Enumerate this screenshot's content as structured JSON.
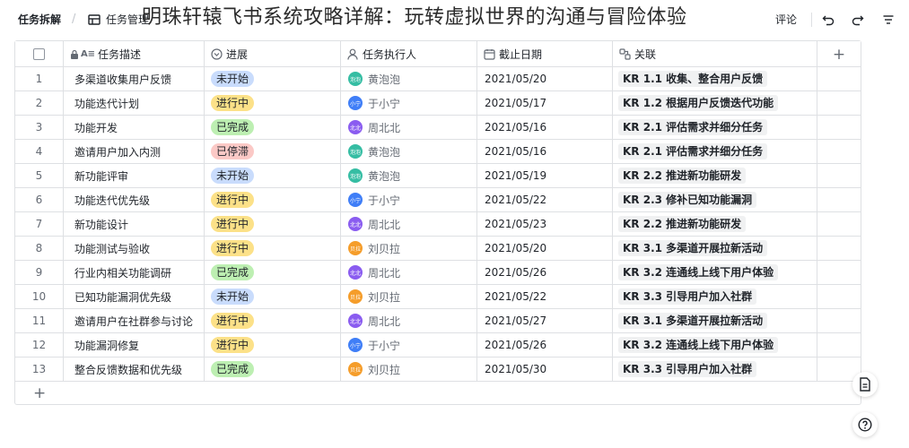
{
  "topbar": {
    "tab_active": "任务拆解",
    "tab_second": "任务管理",
    "overlay_title": "明珠轩辕飞书系统攻略详解：玩转虚拟世界的沟通与冒险体验",
    "comment_label": "评论"
  },
  "columns": {
    "task": "任务描述",
    "progress": "进展",
    "owner": "任务执行人",
    "due": "截止日期",
    "link": "关联",
    "add": "+"
  },
  "colors": {
    "未开始": "#c9dcfc",
    "进行中": "#fce188",
    "已完成": "#bdefb2",
    "已停滞": "#fbc9c6",
    "黄泡泡": "#35bda3",
    "于小宁": "#3f7ef7",
    "周北北": "#8a5cf0",
    "刘贝拉": "#f59d2a"
  },
  "avatar_text": {
    "黄泡泡": "泡泡",
    "于小宁": "小宁",
    "周北北": "北北",
    "刘贝拉": "贝拉"
  },
  "rows": [
    {
      "num": "1",
      "task": "多渠道收集用户反馈",
      "progress": "未开始",
      "owner": "黄泡泡",
      "due": "2021/05/20",
      "kr": "KR 1.1 收集、整合用户反馈"
    },
    {
      "num": "2",
      "task": "功能迭代计划",
      "progress": "进行中",
      "owner": "于小宁",
      "due": "2021/05/17",
      "kr": "KR 1.2 根据用户反馈迭代功能"
    },
    {
      "num": "3",
      "task": "功能开发",
      "progress": "已完成",
      "owner": "周北北",
      "due": "2021/05/16",
      "kr": "KR 2.1 评估需求并细分任务"
    },
    {
      "num": "4",
      "task": "邀请用户加入内测",
      "progress": "已停滞",
      "owner": "黄泡泡",
      "due": "2021/05/16",
      "kr": "KR 2.1 评估需求并细分任务"
    },
    {
      "num": "5",
      "task": "新功能评审",
      "progress": "未开始",
      "owner": "黄泡泡",
      "due": "2021/05/19",
      "kr": "KR 2.2 推进新功能研发"
    },
    {
      "num": "6",
      "task": "功能迭代优先级",
      "progress": "进行中",
      "owner": "于小宁",
      "due": "2021/05/22",
      "kr": "KR 2.3 修补已知功能漏洞"
    },
    {
      "num": "7",
      "task": "新功能设计",
      "progress": "进行中",
      "owner": "周北北",
      "due": "2021/05/23",
      "kr": "KR 2.2 推进新功能研发"
    },
    {
      "num": "8",
      "task": "功能测试与验收",
      "progress": "进行中",
      "owner": "刘贝拉",
      "due": "2021/05/20",
      "kr": "KR 3.1 多渠道开展拉新活动"
    },
    {
      "num": "9",
      "task": "行业内相关功能调研",
      "progress": "已完成",
      "owner": "周北北",
      "due": "2021/05/26",
      "kr": "KR 3.2 连通线上线下用户体验"
    },
    {
      "num": "10",
      "task": "已知功能漏洞优先级",
      "progress": "未开始",
      "owner": "刘贝拉",
      "due": "2021/05/22",
      "kr": "KR 3.3 引导用户加入社群"
    },
    {
      "num": "11",
      "task": "邀请用户在社群参与讨论",
      "progress": "进行中",
      "owner": "周北北",
      "due": "2021/05/27",
      "kr": "KR 3.1 多渠道开展拉新活动"
    },
    {
      "num": "12",
      "task": "功能漏洞修复",
      "progress": "进行中",
      "owner": "于小宁",
      "due": "2021/05/26",
      "kr": "KR 3.2 连通线上线下用户体验"
    },
    {
      "num": "13",
      "task": "整合反馈数据和优先级",
      "progress": "已完成",
      "owner": "刘贝拉",
      "due": "2021/05/30",
      "kr": "KR 3.3 引导用户加入社群"
    }
  ],
  "add_row": "+"
}
